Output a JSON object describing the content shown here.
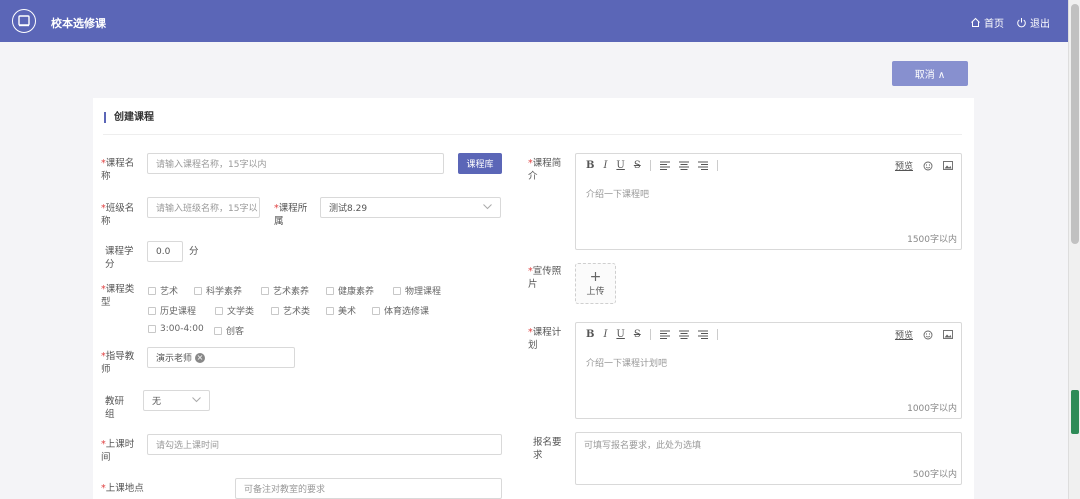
{
  "header": {
    "app_title": "校本选修课",
    "home_label": "首页",
    "logout_label": "退出"
  },
  "actions": {
    "cancel_label": "取消 ∧"
  },
  "form": {
    "title": "创建课程",
    "course_name": {
      "label": "课程名称",
      "placeholder": "请输入课程名称，15字以内",
      "library_button": "课程库"
    },
    "class_name": {
      "label": "班级名称",
      "placeholder": "请输入班级名称，15字以"
    },
    "course_belong": {
      "label": "课程所属",
      "value": "测试8.29"
    },
    "credit": {
      "label": "课程学分",
      "value": "0.0",
      "unit": "分"
    },
    "category": {
      "label": "课程类型",
      "options": [
        "艺术",
        "科学素养",
        "艺术素养",
        "健康素养",
        "物理课程",
        "历史课程",
        "文学类",
        "艺术类",
        "美术",
        "体育选修课",
        "3:00-4:00",
        "创客"
      ]
    },
    "teacher": {
      "label": "指导教师",
      "tag": "演示老师"
    },
    "research_group": {
      "label": "教研组",
      "value": "无"
    },
    "class_time": {
      "label": "上课时间",
      "placeholder": "请勾选上课时间"
    },
    "location": {
      "label": "上课地点",
      "placeholder": "可备注对教室的要求"
    },
    "intro": {
      "label": "课程简介",
      "placeholder": "介绍一下课程吧",
      "count": "1500字以内"
    },
    "photo": {
      "label": "宣传照片",
      "upload_label": "上传"
    },
    "plan": {
      "label": "课程计划",
      "placeholder": "介绍一下课程计划吧",
      "count": "1000字以内"
    },
    "requirement": {
      "label": "报名要求",
      "placeholder": "可填写报名要求，此处为选填",
      "count": "500字以内"
    },
    "editor_toolbar": {
      "bold": "B",
      "italic": "I",
      "underline": "U",
      "strike": "S",
      "preview": "预览"
    }
  },
  "colors": {
    "header": "#5b66b7",
    "accent": "#5b66b7",
    "cancel": "#8790cf",
    "required": "#e04040"
  }
}
